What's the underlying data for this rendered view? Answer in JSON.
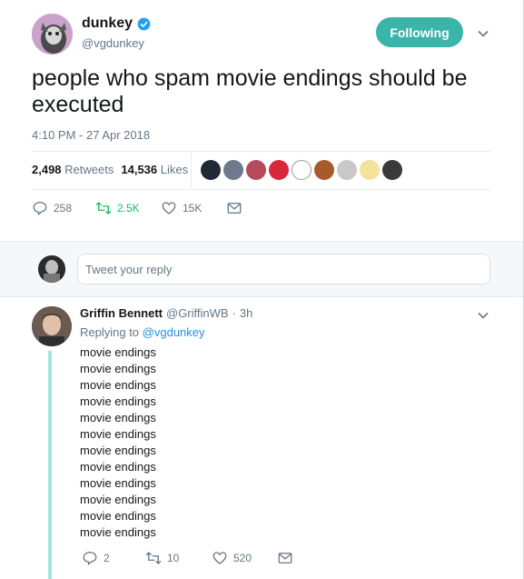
{
  "tweet": {
    "display_name": "dunkey",
    "handle": "@vgdunkey",
    "follow_label": "Following",
    "text": "people who spam movie endings should be executed",
    "timestamp": "4:10 PM - 27 Apr 2018",
    "retweets_count": "2,498",
    "retweets_label": "Retweets",
    "likes_count": "14,536",
    "likes_label": "Likes",
    "actions": {
      "replies": "258",
      "retweets": "2.5K",
      "likes": "15K"
    }
  },
  "composer": {
    "placeholder": "Tweet your reply"
  },
  "reply": {
    "display_name": "Griffin Bennett",
    "handle": "@GriffinWB",
    "separator": "·",
    "time": "3h",
    "replying_prefix": "Replying to",
    "replying_to": "@vgdunkey",
    "lines": [
      "movie endings",
      "movie endings",
      "movie endings",
      "movie endings",
      "movie endings",
      "movie endings",
      "movie endings",
      "movie endings",
      "movie endings",
      "movie endings",
      "movie endings",
      "movie endings"
    ],
    "actions": {
      "replies": "2",
      "retweets": "10",
      "likes": "520"
    }
  },
  "colors": {
    "accent_teal": "#3bb4a9",
    "retweet_green": "#17bf63",
    "link_blue": "#1b95e0",
    "verified_blue": "#1da1f2",
    "muted_text": "#657786"
  },
  "icons": [
    "verified-badge-icon",
    "chevron-down-icon",
    "reply-icon",
    "retweet-icon",
    "like-icon",
    "message-icon"
  ]
}
